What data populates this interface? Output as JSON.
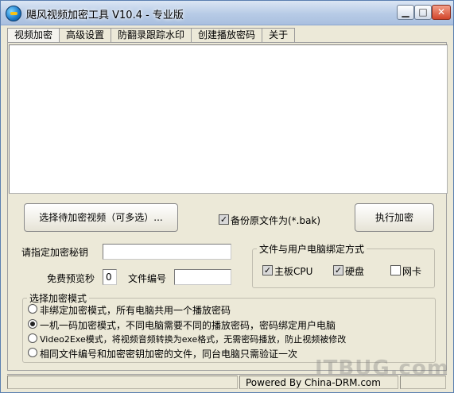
{
  "window": {
    "title": "飓风视频加密工具 V10.4 - 专业版"
  },
  "tabs": [
    "视频加密",
    "高级设置",
    "防翻录跟踪水印",
    "创建播放密码",
    "关于"
  ],
  "buttons": {
    "select_videos": "选择待加密视频（可多选）...",
    "run": "执行加密"
  },
  "backup": {
    "label": "备份原文件为(*.bak)",
    "checked": true
  },
  "key": {
    "label": "请指定加密秘钥",
    "value": ""
  },
  "preview": {
    "label": "免费预览秒",
    "value": "0"
  },
  "file_no": {
    "label": "文件编号",
    "value": ""
  },
  "binding": {
    "title": "文件与用户电脑绑定方式",
    "options": [
      {
        "label": "主板CPU",
        "checked": true
      },
      {
        "label": "硬盘",
        "checked": true
      },
      {
        "label": "网卡",
        "checked": false
      }
    ]
  },
  "mode": {
    "title": "选择加密模式",
    "options": [
      {
        "label": "非绑定加密模式，所有电脑共用一个播放密码",
        "selected": false
      },
      {
        "label": "一机一码加密模式，不同电脑需要不同的播放密码，密码绑定用户电脑",
        "selected": true
      },
      {
        "label": "Video2Exe模式，将视频音频转换为exe格式，无需密码播放，防止视频被修改",
        "selected": false
      },
      {
        "label": "相同文件编号和加密密钥加密的文件，同台电脑只需验证一次",
        "selected": false
      }
    ]
  },
  "status": {
    "text": "Powered By China-DRM.com"
  },
  "watermark": "ITBUG.com"
}
